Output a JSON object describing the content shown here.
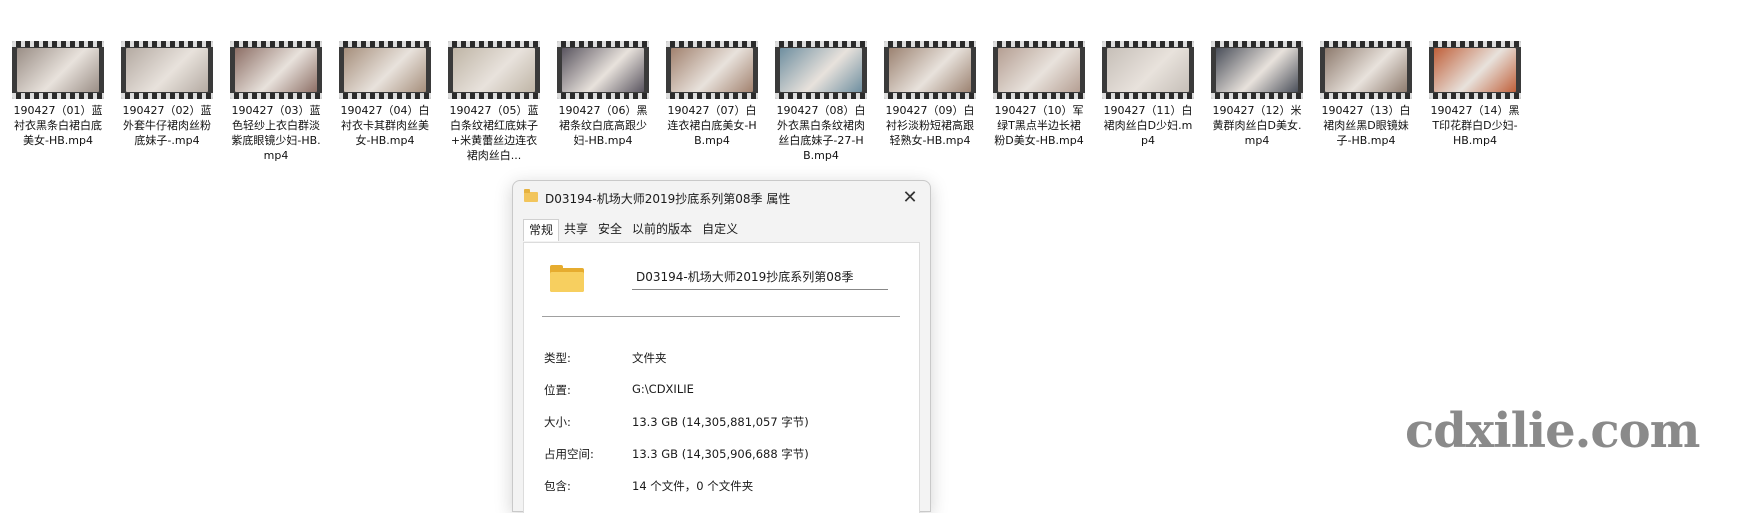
{
  "files": [
    {
      "name": "190427（01）蓝衬衣黑条白裙白底美女-HB.mp4",
      "thumb_color": "#9a8e86"
    },
    {
      "name": "190427（02）蓝外套牛仔裙肉丝粉底妹子-.mp4",
      "thumb_color": "#b4aaa2"
    },
    {
      "name": "190427（03）蓝色轻纱上衣白群淡紫底眼镜少妇-HB.mp4",
      "thumb_color": "#8d6f66"
    },
    {
      "name": "190427（04）白衬衣卡其群肉丝美女-HB.mp4",
      "thumb_color": "#a68f7c"
    },
    {
      "name": "190427（05）蓝白条纹裙红底妹子+米黄蕾丝边连衣裙肉丝白...",
      "thumb_color": "#bfb5a6"
    },
    {
      "name": "190427（06）黑裙条纹白底高跟少妇-HB.mp4",
      "thumb_color": "#5a5560"
    },
    {
      "name": "190427（07）白连衣裙白底美女-HB.mp4",
      "thumb_color": "#a2826f"
    },
    {
      "name": "190427（08）白外衣黑白条纹裙肉丝白底妹子-27-HB.mp4",
      "thumb_color": "#6f8fa0"
    },
    {
      "name": "190427（09）白衬衫淡粉短裙高跟轻熟女-HB.mp4",
      "thumb_color": "#9c8372"
    },
    {
      "name": "190427（10）军绿T黑点半边长裙粉D美女-HB.mp4",
      "thumb_color": "#b59f93"
    },
    {
      "name": "190427（11）白裙肉丝白D少妇.mp4",
      "thumb_color": "#c6bfb8"
    },
    {
      "name": "190427（12）米黄群肉丝白D美女.mp4",
      "thumb_color": "#4a4f5a"
    },
    {
      "name": "190427（13）白裙肉丝黑D眼镜妹子-HB.mp4",
      "thumb_color": "#8e7b6e"
    },
    {
      "name": "190427（14）黑T印花群白D少妇-HB.mp4",
      "thumb_color": "#c0603a"
    }
  ],
  "dialog": {
    "title": "D03194-机场大师2019抄底系列第08季 属性",
    "close_symbol": "✕",
    "tabs": [
      "常规",
      "共享",
      "安全",
      "以前的版本",
      "自定义"
    ],
    "folder_name": "D03194-机场大师2019抄底系列第08季",
    "properties": [
      {
        "label": "类型:",
        "value": "文件夹"
      },
      {
        "label": "位置:",
        "value": "G:\\CDXILIE"
      },
      {
        "label": "大小:",
        "value": "13.3 GB (14,305,881,057 字节)"
      },
      {
        "label": "占用空间:",
        "value": "13.3 GB (14,305,906,688 字节)"
      },
      {
        "label": "包含:",
        "value": "14 个文件，0 个文件夹"
      }
    ]
  },
  "watermark": "cdxilie.com"
}
